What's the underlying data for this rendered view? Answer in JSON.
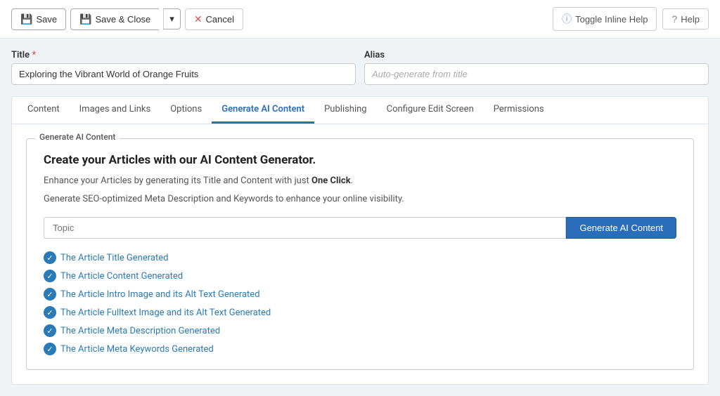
{
  "toolbar": {
    "save_label": "Save",
    "save_close_label": "Save & Close",
    "dropdown_label": "▾",
    "cancel_label": "Cancel",
    "toggle_help_label": "Toggle Inline Help",
    "help_label": "Help"
  },
  "title_field": {
    "label": "Title",
    "required": "*",
    "value": "Exploring the Vibrant World of Orange Fruits",
    "placeholder": ""
  },
  "alias_field": {
    "label": "Alias",
    "placeholder": "Auto-generate from title"
  },
  "tabs": [
    {
      "id": "content",
      "label": "Content"
    },
    {
      "id": "images-links",
      "label": "Images and Links"
    },
    {
      "id": "options",
      "label": "Options"
    },
    {
      "id": "generate-ai",
      "label": "Generate AI Content"
    },
    {
      "id": "publishing",
      "label": "Publishing"
    },
    {
      "id": "configure-edit",
      "label": "Configure Edit Screen"
    },
    {
      "id": "permissions",
      "label": "Permissions"
    }
  ],
  "ai_panel": {
    "legend": "Generate AI Content",
    "headline": "Create your Articles with our AI Content Generator.",
    "desc1_text": "Enhance your Articles by generating its Title and Content with just ",
    "desc1_bold": "One Click",
    "desc1_end": ".",
    "desc2": "Generate SEO-optimized Meta Description and Keywords to enhance your online visibility.",
    "topic_placeholder": "Topic",
    "generate_button": "Generate AI Content",
    "generated_items": [
      "The Article Title Generated",
      "The Article Content Generated",
      "The Article Intro Image and its Alt Text Generated",
      "The Article Fulltext Image and its Alt Text Generated",
      "The Article Meta Description Generated",
      "The Article Meta Keywords Generated"
    ]
  }
}
